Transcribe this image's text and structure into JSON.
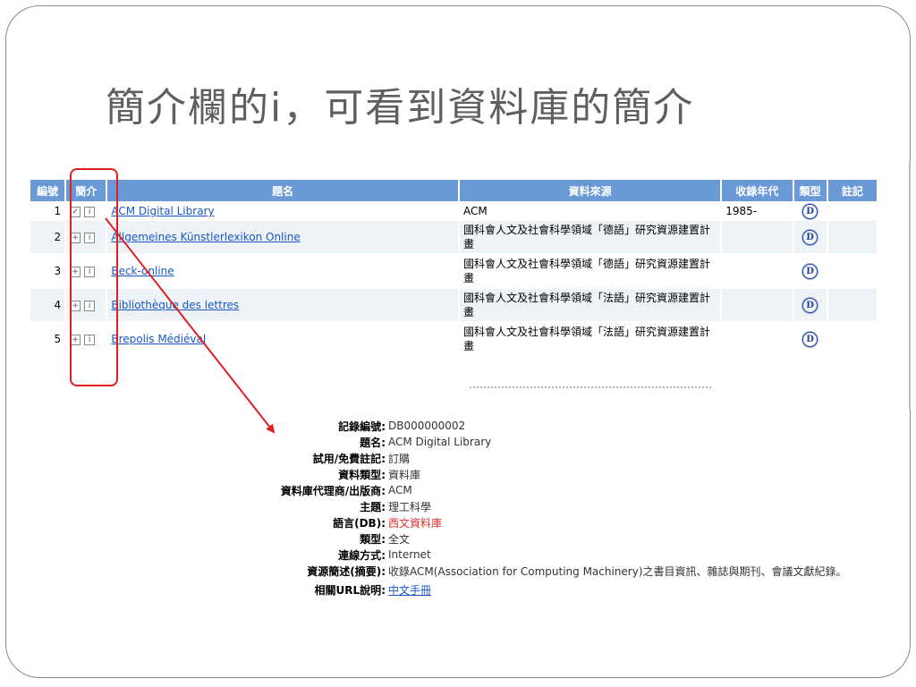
{
  "slide": {
    "title": "簡介欄的i，可看到資料庫的簡介"
  },
  "table": {
    "headers": [
      "編號",
      "簡介",
      "題名",
      "資料來源",
      "收錄年代",
      "類型",
      "註記"
    ],
    "rows": [
      {
        "no": "1",
        "expand_icon": "checked-box-icon",
        "info_icon": "info-icon",
        "title": "ACM Digital Library",
        "source": "ACM",
        "year": "1985-",
        "type_icon": "database-d-icon"
      },
      {
        "no": "2",
        "expand_icon": "plus-box-icon",
        "info_icon": "info-icon",
        "title": "Allgemeines Künstlerlexikon Online",
        "source": "國科會人文及社會科學領域「德語」研究資源建置計畫",
        "year": "",
        "type_icon": "database-d-icon"
      },
      {
        "no": "3",
        "expand_icon": "plus-box-icon",
        "info_icon": "info-icon",
        "title": "Beck-online",
        "source": "國科會人文及社會科學領域「德語」研究資源建置計畫",
        "year": "",
        "type_icon": "database-d-icon"
      },
      {
        "no": "4",
        "expand_icon": "plus-box-icon",
        "info_icon": "info-icon",
        "title": "Bibliothèque des lettres",
        "source": "國科會人文及社會科學領域「法語」研究資源建置計畫",
        "year": "",
        "type_icon": "database-d-icon"
      },
      {
        "no": "5",
        "expand_icon": "plus-box-icon",
        "info_icon": "info-icon",
        "title": "Brepolis Médiéval",
        "source": "國科會人文及社會科學領域「法語」研究資源建置計畫",
        "year": "",
        "type_icon": "database-d-icon"
      }
    ],
    "type_glyph": "D",
    "check_glyph": "✓",
    "plus_glyph": "+",
    "info_glyph": "i"
  },
  "detail": {
    "fields": [
      {
        "label": "記錄編號",
        "value": "DB000000002"
      },
      {
        "label": "題名",
        "value": "ACM Digital Library"
      },
      {
        "label": "試用/免費註記",
        "value": "訂購"
      },
      {
        "label": "資料類型",
        "value": "資料庫"
      },
      {
        "label": "資料庫代理商/出版商",
        "value": "ACM"
      },
      {
        "label": "主題",
        "value": "理工科學"
      },
      {
        "label": "語言(DB)",
        "value": "西文資料庫"
      },
      {
        "label": "類型",
        "value": "全文"
      },
      {
        "label": "連線方式",
        "value": "Internet"
      },
      {
        "label": "資源簡述(摘要)",
        "value": "收錄ACM(Association for Computing Machinery)之書目資訊、雜誌與期刊、會議文獻紀錄。"
      }
    ],
    "url_label": "相關URL說明",
    "url_value": "中文手冊"
  },
  "annotation": {
    "highlight_color": "#e02020",
    "arrow_color": "#e02020"
  },
  "colors": {
    "header_bg": "#6a9ad6",
    "link": "#1a57c4",
    "title_text": "#5f5f5f"
  }
}
